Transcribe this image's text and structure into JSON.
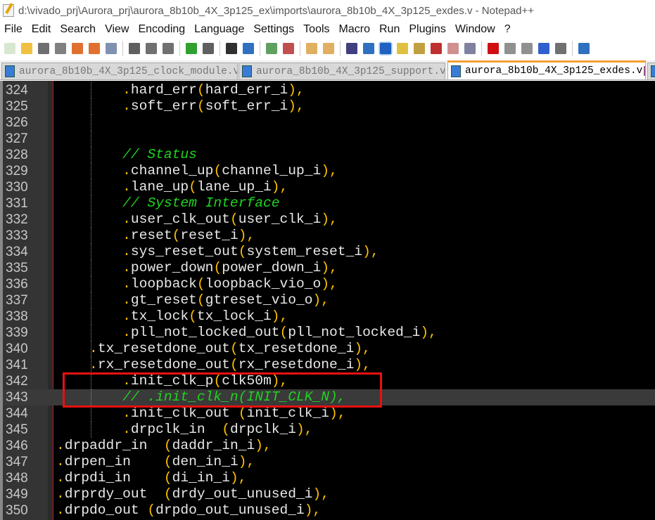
{
  "window": {
    "title": "d:\\vivado_prj\\Aurora_prj\\aurora_8b10b_4X_3p125_ex\\imports\\aurora_8b10b_4X_3p125_exdes.v - Notepad++"
  },
  "menu": [
    "File",
    "Edit",
    "Search",
    "View",
    "Encoding",
    "Language",
    "Settings",
    "Tools",
    "Macro",
    "Run",
    "Plugins",
    "Window",
    "?"
  ],
  "toolbar": [
    "new-file-icon",
    "open-file-icon",
    "save-icon",
    "save-all-icon",
    "close-icon",
    "close-all-icon",
    "print-icon",
    "cut-icon",
    "copy-icon",
    "paste-icon",
    "undo-icon",
    "redo-icon",
    "find-icon",
    "replace-icon",
    "zoom-in-icon",
    "zoom-out-icon",
    "sync-vertical-icon",
    "sync-horizontal-icon",
    "word-wrap-icon",
    "show-all-chars-icon",
    "indent-guide-icon",
    "udl-icon",
    "doc-map-icon",
    "function-list-icon",
    "folder-workspace-icon",
    "monitoring-icon",
    "record-macro-icon",
    "stop-record-icon",
    "play-macro-icon",
    "run-macro-multiple-icon",
    "save-macro-icon",
    "plugin-icon"
  ],
  "tabs": [
    {
      "label": "aurora_8b10b_4X_3p125_clock_module.v",
      "active": false
    },
    {
      "label": "aurora_8b10b_4X_3p125_support.v",
      "active": false
    },
    {
      "label": "aurora_8b10b_4X_3p125_exdes.v",
      "active": true
    }
  ],
  "editor": {
    "current_line": 343,
    "highlight_lines": [
      342,
      343
    ],
    "lines": [
      {
        "n": "324",
        "indent": 8,
        "tokens": [
          [
            "p",
            "."
          ],
          [
            "t",
            "hard_err"
          ],
          [
            "p",
            "("
          ],
          [
            "t",
            "hard_err_i"
          ],
          [
            "p",
            "),"
          ]
        ]
      },
      {
        "n": "325",
        "indent": 8,
        "tokens": [
          [
            "p",
            "."
          ],
          [
            "t",
            "soft_err"
          ],
          [
            "p",
            "("
          ],
          [
            "t",
            "soft_err_i"
          ],
          [
            "p",
            "),"
          ]
        ]
      },
      {
        "n": "326",
        "indent": 0,
        "tokens": []
      },
      {
        "n": "327",
        "indent": 0,
        "tokens": []
      },
      {
        "n": "328",
        "indent": 8,
        "tokens": [
          [
            "c",
            "// Status"
          ]
        ]
      },
      {
        "n": "329",
        "indent": 8,
        "tokens": [
          [
            "p",
            "."
          ],
          [
            "t",
            "channel_up"
          ],
          [
            "p",
            "("
          ],
          [
            "t",
            "channel_up_i"
          ],
          [
            "p",
            "),"
          ]
        ]
      },
      {
        "n": "330",
        "indent": 8,
        "tokens": [
          [
            "p",
            "."
          ],
          [
            "t",
            "lane_up"
          ],
          [
            "p",
            "("
          ],
          [
            "t",
            "lane_up_i"
          ],
          [
            "p",
            "),"
          ]
        ]
      },
      {
        "n": "331",
        "indent": 8,
        "tokens": [
          [
            "c",
            "// System Interface"
          ]
        ]
      },
      {
        "n": "332",
        "indent": 8,
        "tokens": [
          [
            "p",
            "."
          ],
          [
            "t",
            "user_clk_out"
          ],
          [
            "p",
            "("
          ],
          [
            "t",
            "user_clk_i"
          ],
          [
            "p",
            "),"
          ]
        ]
      },
      {
        "n": "333",
        "indent": 8,
        "tokens": [
          [
            "p",
            "."
          ],
          [
            "t",
            "reset"
          ],
          [
            "p",
            "("
          ],
          [
            "t",
            "reset_i"
          ],
          [
            "p",
            "),"
          ]
        ]
      },
      {
        "n": "334",
        "indent": 8,
        "tokens": [
          [
            "p",
            "."
          ],
          [
            "t",
            "sys_reset_out"
          ],
          [
            "p",
            "("
          ],
          [
            "t",
            "system_reset_i"
          ],
          [
            "p",
            "),"
          ]
        ]
      },
      {
        "n": "335",
        "indent": 8,
        "tokens": [
          [
            "p",
            "."
          ],
          [
            "t",
            "power_down"
          ],
          [
            "p",
            "("
          ],
          [
            "t",
            "power_down_i"
          ],
          [
            "p",
            "),"
          ]
        ]
      },
      {
        "n": "336",
        "indent": 8,
        "tokens": [
          [
            "p",
            "."
          ],
          [
            "t",
            "loopback"
          ],
          [
            "p",
            "("
          ],
          [
            "t",
            "loopback_vio_o"
          ],
          [
            "p",
            "),"
          ]
        ]
      },
      {
        "n": "337",
        "indent": 8,
        "tokens": [
          [
            "p",
            "."
          ],
          [
            "t",
            "gt_reset"
          ],
          [
            "p",
            "("
          ],
          [
            "t",
            "gtreset_vio_o"
          ],
          [
            "p",
            "),"
          ]
        ]
      },
      {
        "n": "338",
        "indent": 8,
        "tokens": [
          [
            "p",
            "."
          ],
          [
            "t",
            "tx_lock"
          ],
          [
            "p",
            "("
          ],
          [
            "t",
            "tx_lock_i"
          ],
          [
            "p",
            "),"
          ]
        ]
      },
      {
        "n": "339",
        "indent": 8,
        "tokens": [
          [
            "p",
            "."
          ],
          [
            "t",
            "pll_not_locked_out"
          ],
          [
            "p",
            "("
          ],
          [
            "t",
            "pll_not_locked_i"
          ],
          [
            "p",
            "),"
          ]
        ]
      },
      {
        "n": "340",
        "indent": 4,
        "tokens": [
          [
            "p",
            "."
          ],
          [
            "t",
            "tx_resetdone_out"
          ],
          [
            "p",
            "("
          ],
          [
            "t",
            "tx_resetdone_i"
          ],
          [
            "p",
            "),"
          ]
        ]
      },
      {
        "n": "341",
        "indent": 4,
        "tokens": [
          [
            "p",
            "."
          ],
          [
            "t",
            "rx_resetdone_out"
          ],
          [
            "p",
            "("
          ],
          [
            "t",
            "rx_resetdone_i"
          ],
          [
            "p",
            "),"
          ]
        ]
      },
      {
        "n": "342",
        "indent": 8,
        "tokens": [
          [
            "p",
            "."
          ],
          [
            "t",
            "init_clk_p"
          ],
          [
            "p",
            "("
          ],
          [
            "t",
            "clk50m"
          ],
          [
            "p",
            "),"
          ]
        ]
      },
      {
        "n": "343",
        "indent": 8,
        "tokens": [
          [
            "c",
            "// .init_clk_n(INIT_CLK_N),"
          ]
        ]
      },
      {
        "n": "344",
        "indent": 8,
        "tokens": [
          [
            "p",
            "."
          ],
          [
            "t",
            "init_clk_out "
          ],
          [
            "p",
            "("
          ],
          [
            "t",
            "init_clk_i"
          ],
          [
            "p",
            "),"
          ]
        ]
      },
      {
        "n": "345",
        "indent": 8,
        "tokens": [
          [
            "p",
            "."
          ],
          [
            "t",
            "drpclk_in  "
          ],
          [
            "p",
            "("
          ],
          [
            "t",
            "drpclk_i"
          ],
          [
            "p",
            "),"
          ]
        ]
      },
      {
        "n": "346",
        "indent": 0,
        "tokens": [
          [
            "p",
            "."
          ],
          [
            "t",
            "drpaddr_in  "
          ],
          [
            "p",
            "("
          ],
          [
            "t",
            "daddr_in_i"
          ],
          [
            "p",
            "),"
          ]
        ]
      },
      {
        "n": "347",
        "indent": 0,
        "tokens": [
          [
            "p",
            "."
          ],
          [
            "t",
            "drpen_in    "
          ],
          [
            "p",
            "("
          ],
          [
            "t",
            "den_in_i"
          ],
          [
            "p",
            "),"
          ]
        ]
      },
      {
        "n": "348",
        "indent": 0,
        "tokens": [
          [
            "p",
            "."
          ],
          [
            "t",
            "drpdi_in    "
          ],
          [
            "p",
            "("
          ],
          [
            "t",
            "di_in_i"
          ],
          [
            "p",
            "),"
          ]
        ]
      },
      {
        "n": "349",
        "indent": 0,
        "tokens": [
          [
            "p",
            "."
          ],
          [
            "t",
            "drprdy_out  "
          ],
          [
            "p",
            "("
          ],
          [
            "t",
            "drdy_out_unused_i"
          ],
          [
            "p",
            "),"
          ]
        ]
      },
      {
        "n": "350",
        "indent": 0,
        "tokens": [
          [
            "p",
            "."
          ],
          [
            "t",
            "drpdo_out "
          ],
          [
            "p",
            "("
          ],
          [
            "t",
            "drpdo_out_unused_i"
          ],
          [
            "p",
            "),"
          ]
        ]
      }
    ]
  }
}
